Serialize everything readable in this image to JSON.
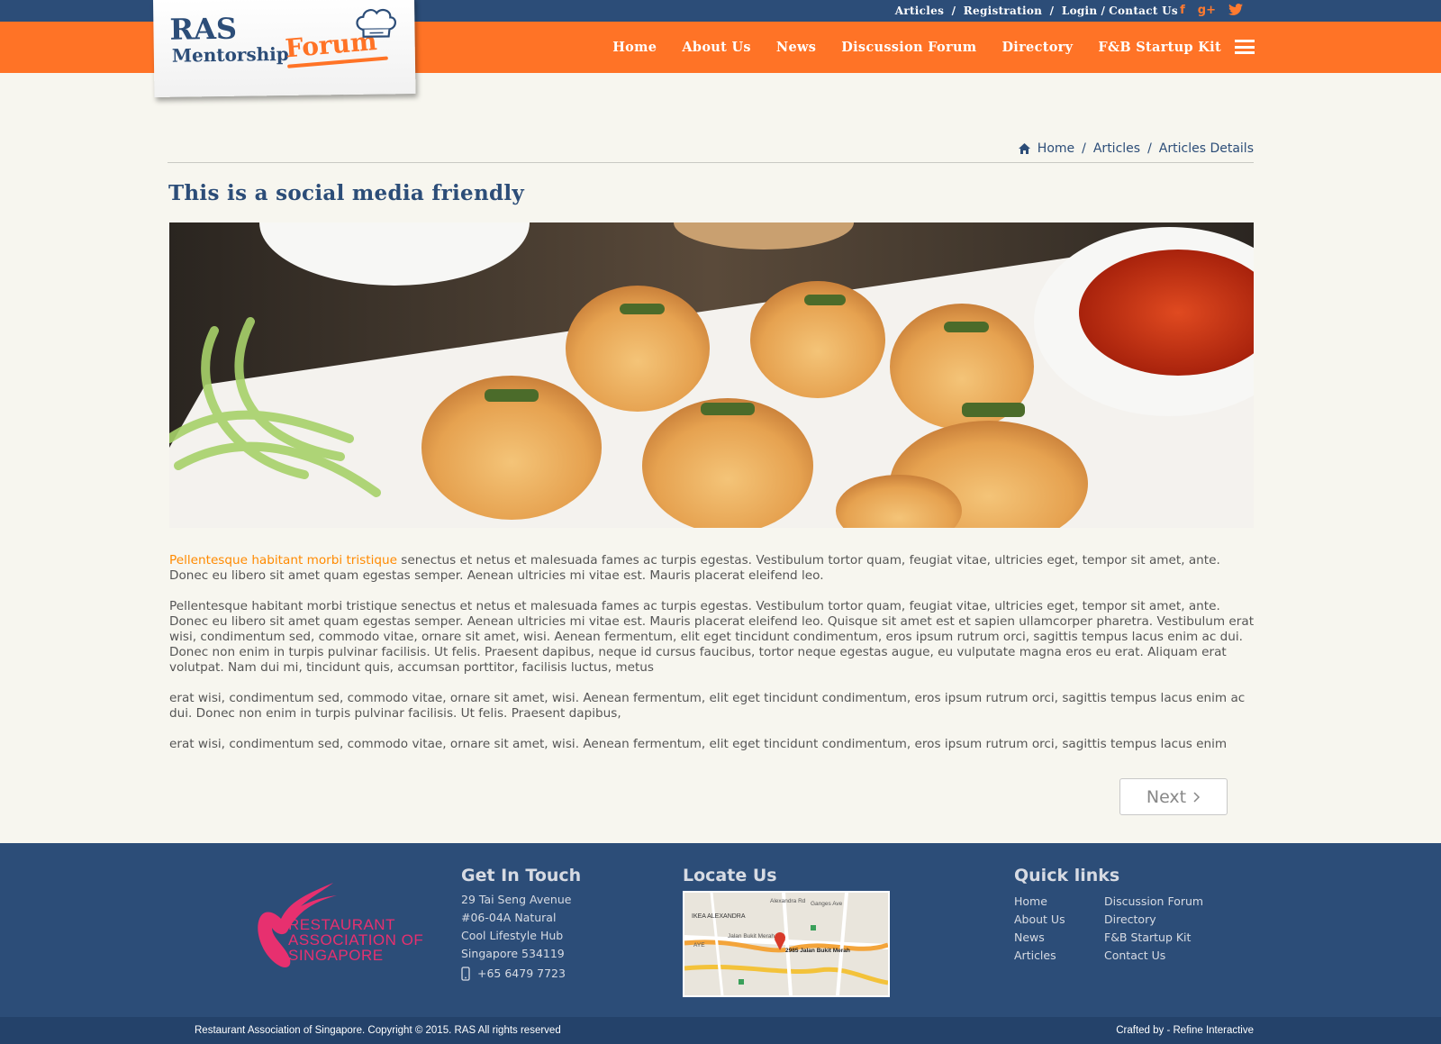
{
  "colors": {
    "navy": "#2c4d78",
    "orange": "#ff7326",
    "highlight": "#ff8a00",
    "background": "#f7f6ef",
    "ras_pink": "#e7306f"
  },
  "topbar": {
    "articles": "Articles",
    "registration": "Registration",
    "login": "Login",
    "contact": "Contact Us",
    "social": [
      "facebook-icon",
      "google-plus-icon",
      "twitter-icon"
    ]
  },
  "logo": {
    "line1": "RAS",
    "line2": "Mentorship",
    "line3": "Forum",
    "icon": "chef-hat-icon"
  },
  "nav": {
    "items": [
      "Home",
      "About Us",
      "News",
      "Discussion Forum",
      "Directory",
      "F&B Startup Kit"
    ],
    "menu_icon": "hamburger-icon"
  },
  "breadcrumb": {
    "items": [
      "Home",
      "Articles",
      "Articles Details"
    ],
    "icon": "home-icon"
  },
  "article": {
    "title": "This is a social media friendly",
    "image": "dumplings-photo",
    "p1_highlight": "Pellentesque habitant morbi tristique",
    "p1_rest": " senectus et netus et malesuada fames ac turpis egestas. Vestibulum tortor quam, feugiat vitae, ultricies eget, tempor sit amet, ante. Donec eu libero sit amet quam egestas semper. Aenean ultricies mi vitae est. Mauris placerat eleifend leo.",
    "p2": "Pellentesque habitant morbi tristique senectus et netus et malesuada fames ac turpis egestas. Vestibulum tortor quam, feugiat vitae, ultricies eget, tempor sit amet, ante. Donec eu libero sit amet quam egestas semper. Aenean ultricies mi vitae est. Mauris placerat eleifend leo. Quisque sit amet est et sapien ullamcorper pharetra. Vestibulum erat wisi, condimentum sed, commodo vitae, ornare sit amet, wisi. Aenean fermentum, elit eget tincidunt condimentum, eros ipsum rutrum orci, sagittis tempus lacus enim ac dui. Donec non enim in turpis pulvinar facilisis. Ut felis. Praesent dapibus, neque id cursus faucibus, tortor neque egestas augue, eu vulputate magna eros eu erat. Aliquam erat volutpat. Nam dui mi, tincidunt quis, accumsan porttitor, facilisis luctus, metus",
    "p3": "erat wisi, condimentum sed, commodo vitae, ornare sit amet, wisi. Aenean fermentum, elit eget tincidunt condimentum, eros ipsum rutrum orci, sagittis tempus lacus enim ac dui. Donec non enim in turpis pulvinar facilisis. Ut felis. Praesent dapibus,",
    "p4": "erat wisi, condimentum sed, commodo vitae, ornare sit amet, wisi. Aenean fermentum, elit eget tincidunt condimentum, eros ipsum rutrum orci, sagittis tempus lacus enim",
    "next_label": "Next"
  },
  "footer": {
    "org_logo_lines": [
      "RESTAURANT",
      "ASSOCIATION OF",
      "SINGAPORE"
    ],
    "get_in_touch": {
      "title": "Get In Touch",
      "address": [
        "29 Tai Seng Avenue",
        "#06-04A Natural",
        "Cool Lifestyle Hub",
        "Singapore 534119"
      ],
      "phone": "+65 6479 7723",
      "phone_icon": "mobile-phone-icon"
    },
    "locate_us": {
      "title": "Locate Us",
      "map_labels": [
        "IKEA ALEXANDRA",
        "Alexandra Rd",
        "Jalan Bukit Merah",
        "2985 Jalan Bukit Merah",
        "AYE",
        "Ganges Ave"
      ]
    },
    "quick_links": {
      "title": "Quick links",
      "items": [
        "Home",
        "Discussion Forum",
        "About Us",
        "Directory",
        "News",
        "F&B Startup Kit",
        "Articles",
        "Contact Us"
      ]
    }
  },
  "copyright": {
    "left": "Restaurant Association of Singapore. Copyright © 2015. RAS All rights reserved",
    "right": "Crafted by - Refine Interactive"
  }
}
